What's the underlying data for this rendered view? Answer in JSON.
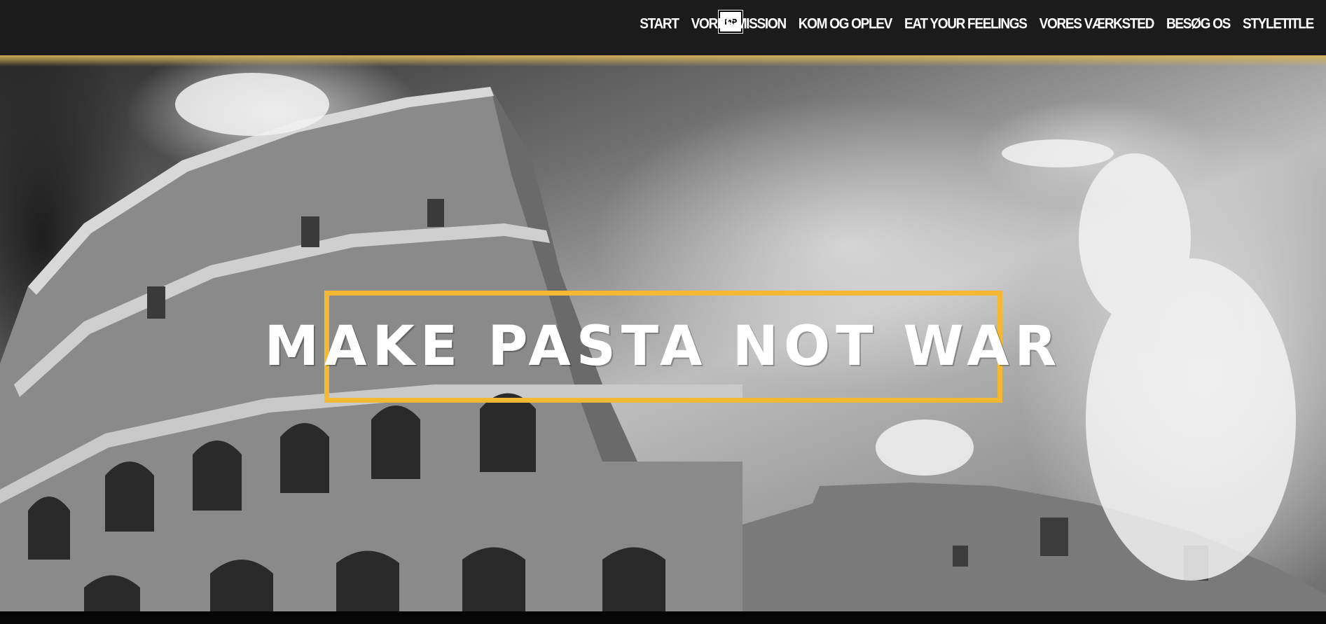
{
  "logo": {
    "text": "MP"
  },
  "nav": {
    "items": [
      {
        "label": "START"
      },
      {
        "label": "VORES MISSION"
      },
      {
        "label": "KOM OG OPLEV"
      },
      {
        "label": "EAT YOUR FEELINGS"
      },
      {
        "label": "VORES VÆRKSTED"
      },
      {
        "label": "BESØG OS"
      },
      {
        "label": "STYLETITLE"
      }
    ]
  },
  "hero": {
    "title": "Make pasta not War",
    "image": "colosseum-black-and-white",
    "accent_color": "#f3b935"
  },
  "colors": {
    "topbar": "#1b1b1b",
    "accent": "#f3b935",
    "nav_text": "#ffffff"
  }
}
